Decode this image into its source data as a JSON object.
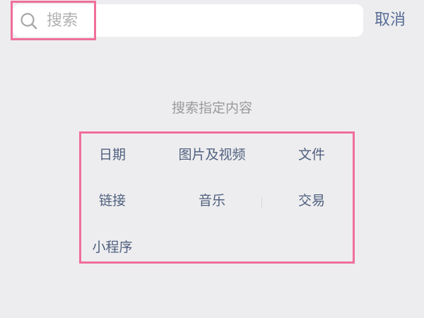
{
  "search": {
    "placeholder": "搜索",
    "value": ""
  },
  "cancel_label": "取消",
  "hint": "搜索指定内容",
  "categories": [
    {
      "label": "日期"
    },
    {
      "label": "图片及视频"
    },
    {
      "label": "文件"
    },
    {
      "label": "链接"
    },
    {
      "label": "音乐"
    },
    {
      "label": "交易"
    },
    {
      "label": "小程序"
    }
  ],
  "colors": {
    "background": "#ededef",
    "link": "#576b95",
    "category_text": "#50607f",
    "hint_text": "#9a9a9c",
    "highlight": "#f06e9a"
  },
  "icons": {
    "search": "search-icon"
  }
}
